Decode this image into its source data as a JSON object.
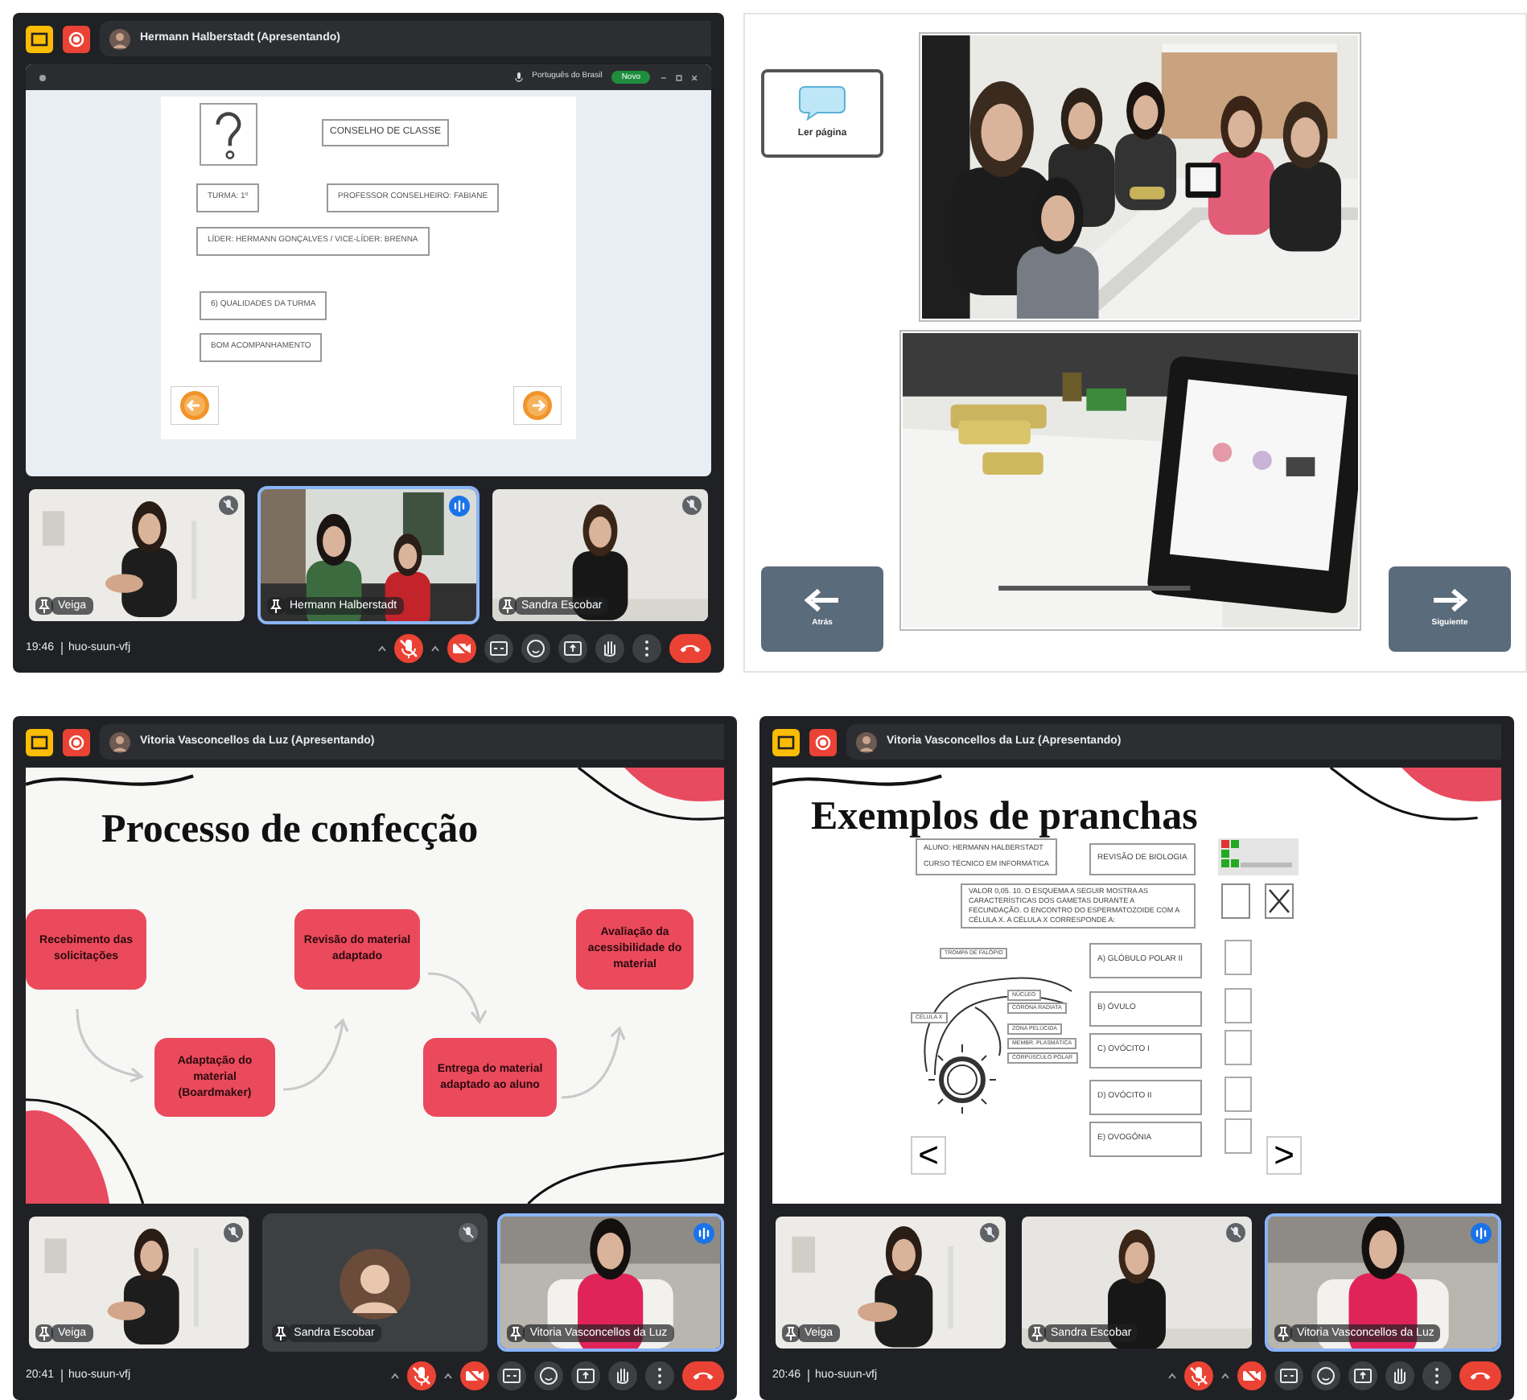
{
  "panels": [
    {
      "kind": "meet",
      "presenter": "Hermann Halberstadt (Apresentando)",
      "content": {
        "kind": "browser_board",
        "language": "Português do Brasil",
        "badge": "Novo",
        "title": "CONSELHO DE CLASSE",
        "fields": [
          "TURMA: 1º",
          "PROFESSOR CONSELHEIRO: FABIANE",
          "LÍDER: HERMANN GONÇALVES / VICE-LÍDER: BRENNA",
          "6) QUALIDADES DA TURMA",
          "BOM ACOMPANHAMENTO"
        ]
      },
      "tiles": [
        {
          "name": "Veiga",
          "kind": "video",
          "speaking": false
        },
        {
          "name": "Hermann Halberstadt",
          "kind": "video",
          "speaking": true
        },
        {
          "name": "Sandra Escobar",
          "kind": "video",
          "speaking": false
        }
      ],
      "time": "19:46",
      "code": "huo-suun-vfj"
    },
    {
      "kind": "board_app",
      "read_button": "Ler página",
      "back_button": "Atrás",
      "next_button": "Siguiente"
    },
    {
      "kind": "meet",
      "presenter": "Vitoria Vasconcellos da Luz (Apresentando)",
      "content": {
        "kind": "flow_slide",
        "title": "Processo de confecção",
        "steps": [
          "Recebimento das solicitações",
          "Adaptação do material (Boardmaker)",
          "Revisão do material adaptado",
          "Entrega do material adaptado ao aluno",
          "Avaliação da acessibilidade do material"
        ]
      },
      "tiles": [
        {
          "name": "Veiga",
          "kind": "video",
          "speaking": false
        },
        {
          "name": "Sandra Escobar",
          "kind": "avatar",
          "speaking": false
        },
        {
          "name": "Vitoria Vasconcellos da Luz",
          "kind": "video",
          "speaking": true
        }
      ],
      "time": "20:41",
      "code": "huo-suun-vfj"
    },
    {
      "kind": "meet",
      "presenter": "Vitoria Vasconcellos da Luz (Apresentando)",
      "content": {
        "kind": "pranchas_slide",
        "title": "Exemplos de pranchas",
        "header": [
          "ALUNO: HERMANN HALBERSTADT",
          "CURSO TÉCNICO EM INFORMÁTICA"
        ],
        "subject": "REVISÃO DE BIOLOGIA",
        "question": "VALOR 0,05. 10. O ESQUEMA A SEGUIR MOSTRA AS CARACTERÍSTICAS DOS GAMETAS DURANTE A FECUNDAÇÃO. O ENCONTRO DO ESPERMATOZOIDE COM A CÉLULA X. A CÉLULA X CORRESPONDE A:",
        "marks": [
          {
            "checked": false
          },
          {
            "checked": true
          }
        ],
        "diagram_labels": [
          "TROMPA DE FALÓPIO",
          "CÉLULA X",
          "NÚCLEO",
          "CORONA RADIATA",
          "ZONA PELÚCIDA",
          "MEMBR. PLASMÁTICA",
          "CORPÚSCULO POLAR"
        ],
        "options": [
          {
            "text": "A) GLÓBULO POLAR II",
            "checked": false
          },
          {
            "text": "B) ÓVULO",
            "checked": false
          },
          {
            "text": "C) OVÓCITO I",
            "checked": false
          },
          {
            "text": "D) OVÓCITO II",
            "checked": false
          },
          {
            "text": "E) OVOGÔNIA",
            "checked": false
          }
        ],
        "prev": "<",
        "next": ">"
      },
      "tiles": [
        {
          "name": "Veiga",
          "kind": "video",
          "speaking": false
        },
        {
          "name": "Sandra Escobar",
          "kind": "video",
          "speaking": false
        },
        {
          "name": "Vitoria Vasconcellos da Luz",
          "kind": "video",
          "speaking": true
        }
      ],
      "time": "20:46",
      "code": "huo-suun-vfj"
    }
  ]
}
